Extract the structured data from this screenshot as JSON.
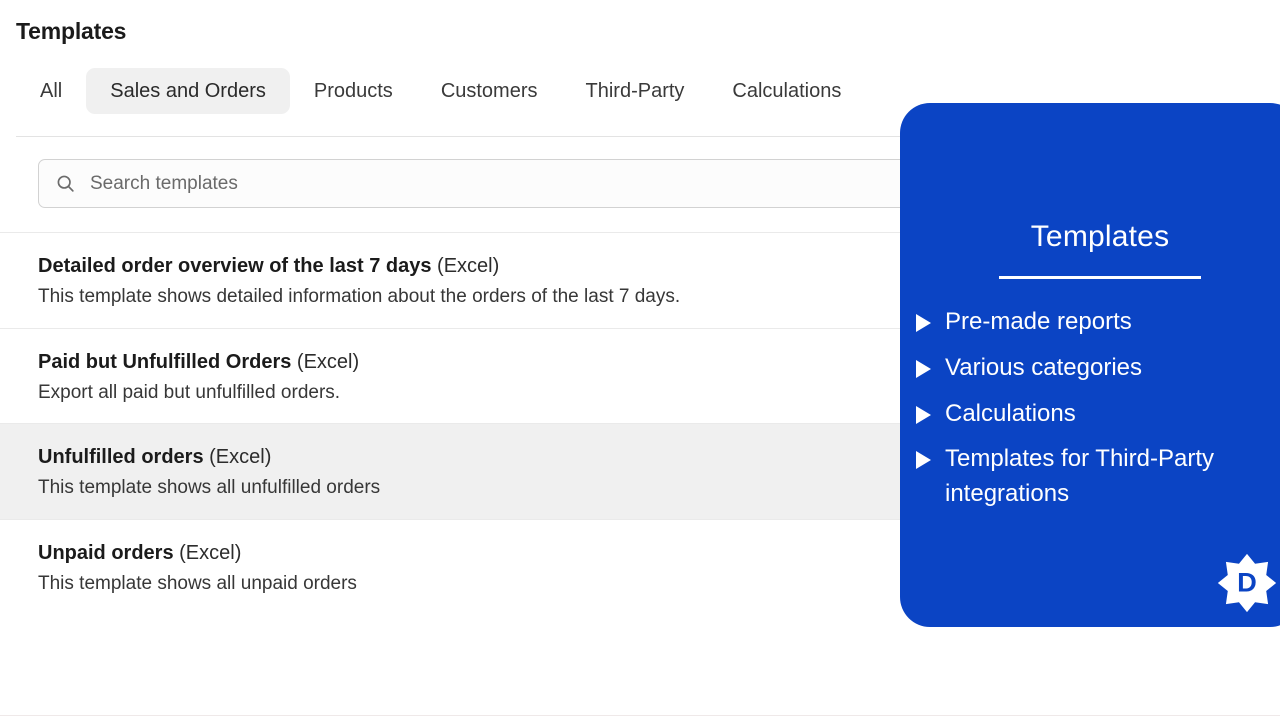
{
  "page": {
    "title": "Templates"
  },
  "tabs": [
    {
      "label": "All",
      "active": false
    },
    {
      "label": "Sales and Orders",
      "active": true
    },
    {
      "label": "Products",
      "active": false
    },
    {
      "label": "Customers",
      "active": false
    },
    {
      "label": "Third-Party",
      "active": false
    },
    {
      "label": "Calculations",
      "active": false
    }
  ],
  "search": {
    "placeholder": "Search templates",
    "value": "",
    "icon": "search-icon"
  },
  "templates": [
    {
      "name": "Detailed order overview of the last 7 days",
      "format": "(Excel)",
      "description": "This template shows detailed information about the orders of the last 7 days.",
      "highlighted": false
    },
    {
      "name": "Paid but Unfulfilled Orders",
      "format": "(Excel)",
      "description": "Export all paid but unfulfilled orders.",
      "highlighted": false
    },
    {
      "name": "Unfulfilled orders",
      "format": "(Excel)",
      "description": "This template shows all unfulfilled orders",
      "highlighted": true
    },
    {
      "name": "Unpaid orders",
      "format": "(Excel)",
      "description": "This template shows all unpaid orders",
      "highlighted": false
    }
  ],
  "promo": {
    "title": "Templates",
    "background_color": "#0b44c4",
    "text_color": "#ffffff",
    "bullets": [
      "Pre-made reports",
      "Various categories",
      "Calculations",
      "Templates for Third-Party integrations"
    ],
    "logo": {
      "icon": "brand-logo-icon",
      "letter": "D"
    }
  }
}
